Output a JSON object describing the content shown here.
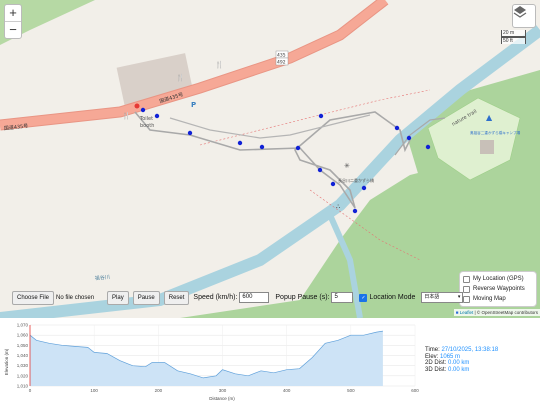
{
  "map": {
    "zoom_in": "+",
    "zoom_out": "−",
    "scale_top": "20 m",
    "scale_bottom": "50 ft",
    "road_label_1": "国道435号",
    "road_label_2": "国道435号",
    "road_label_shield_a": "435",
    "road_label_shield_b": "492",
    "poi_toilet": "Toilet",
    "poi_booth": "booth",
    "poi_park": "長谷川二重かずら橋",
    "poi_campsite": "奥祖谷二重かずら橋キャンプ場",
    "trail_label": "nature trail",
    "river_label": "祖谷川",
    "attribution_leaflet": "Leaflet",
    "attribution_osm": "© OpenStreetMap contributors"
  },
  "legend": {
    "items": [
      {
        "label": "My Location (GPS)"
      },
      {
        "label": "Reverse Waypoints"
      },
      {
        "label": "Moving Map"
      }
    ]
  },
  "controls": {
    "choose_file": "Choose File",
    "no_file": "No file chosen",
    "play": "Play",
    "pause": "Pause",
    "reset": "Reset",
    "speed_label": "Speed (km/h):",
    "speed_value": "600",
    "popup_label": "Popup Pause (s):",
    "popup_value": "5",
    "location_mode_label": "Location Mode",
    "location_mode_value": "日本語"
  },
  "chart_data": {
    "type": "area",
    "xlabel": "Distance (m)",
    "ylabel": "Elevation (m)",
    "xlim": [
      0,
      600
    ],
    "ylim": [
      1010,
      1070
    ],
    "xticks": [
      0,
      100,
      200,
      300,
      400,
      500,
      600
    ],
    "yticks": [
      1010,
      1020,
      1030,
      1040,
      1050,
      1060,
      1070
    ],
    "x": [
      0,
      10,
      30,
      50,
      70,
      90,
      100,
      120,
      140,
      160,
      180,
      190,
      210,
      230,
      250,
      270,
      290,
      300,
      320,
      340,
      360,
      380,
      400,
      420,
      440,
      460,
      480,
      500,
      520,
      540,
      550
    ],
    "y": [
      1060,
      1055,
      1052,
      1050,
      1049,
      1048,
      1043,
      1042,
      1035,
      1030,
      1029,
      1033,
      1033,
      1025,
      1022,
      1018,
      1020,
      1026,
      1022,
      1020,
      1025,
      1023,
      1026,
      1027,
      1038,
      1052,
      1055,
      1060,
      1060,
      1063,
      1064
    ],
    "color": "#9cc9ef"
  },
  "info": {
    "time_label": "Time:",
    "time_value": "27/10/2025, 13:38:18",
    "elev_label": "Elev:",
    "elev_value": "1065 m",
    "dist2d_label": "2D Dist:",
    "dist2d_value": "0.00 km",
    "dist3d_label": "3D Dist:",
    "dist3d_value": "0.00 km"
  }
}
